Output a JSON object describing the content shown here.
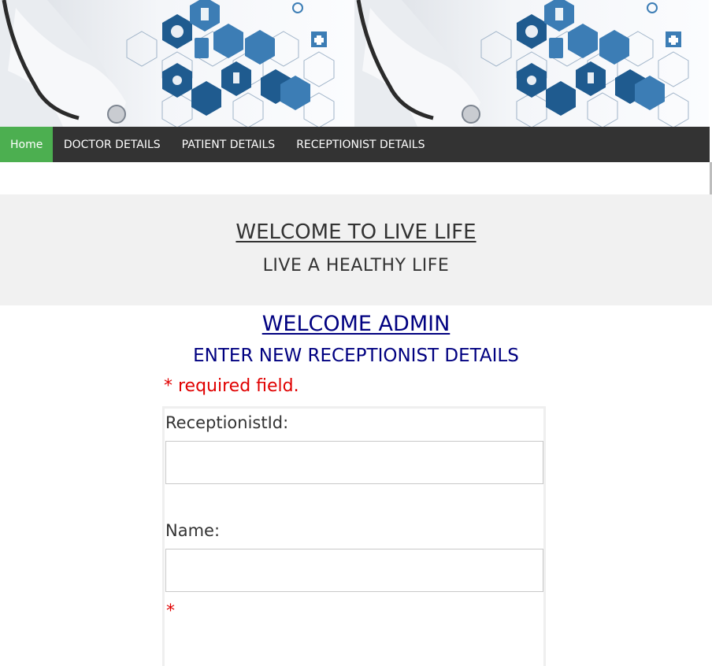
{
  "banner": {
    "icons": [
      "medical-hexagon-icons",
      "stethoscope-icon",
      "heart-icon",
      "eye-icon",
      "pills-icon",
      "first-aid-icon"
    ]
  },
  "nav": {
    "items": [
      {
        "label": "Home",
        "active": true
      },
      {
        "label": "DOCTOR DETAILS",
        "active": false
      },
      {
        "label": "PATIENT DETAILS",
        "active": false
      },
      {
        "label": "RECEPTIONIST DETAILS",
        "active": false
      }
    ],
    "active_color": "#4CAF50",
    "bg_color": "#333333"
  },
  "welcome": {
    "title": "WELCOME TO LIVE LIFE",
    "subtitle": "LIVE A HEALTHY LIFE"
  },
  "admin": {
    "title": "WELCOME ADMIN",
    "subtitle": "ENTER NEW RECEPTIONIST DETAILS",
    "required_note": "* required field."
  },
  "form": {
    "receptionist_id_label": "ReceptionistId:",
    "receptionist_id_value": "",
    "name_label": "Name:",
    "name_value": "",
    "required_star": "*"
  },
  "colors": {
    "title_blue": "#000080",
    "required_red": "#e00000"
  }
}
